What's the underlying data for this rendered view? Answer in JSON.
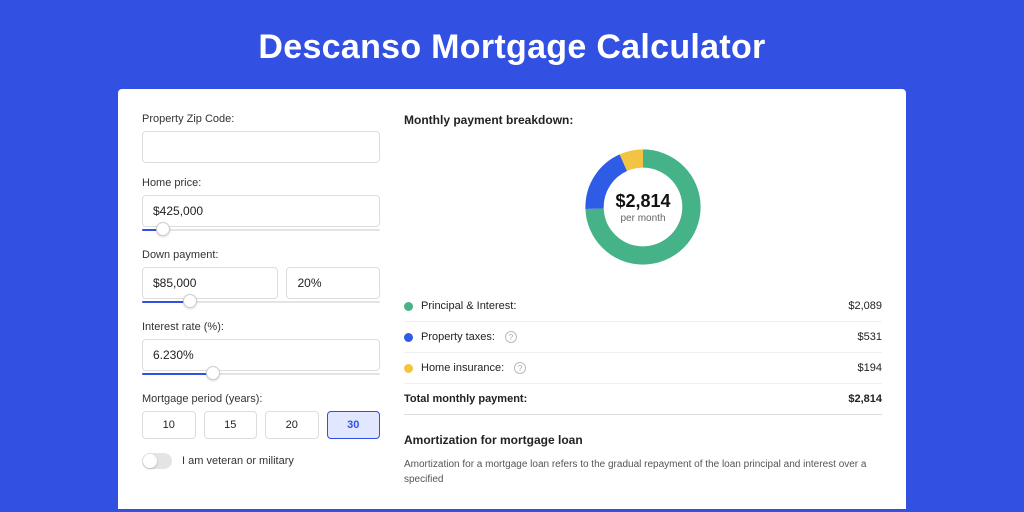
{
  "page": {
    "title": "Descanso Mortgage Calculator"
  },
  "form": {
    "zip": {
      "label": "Property Zip Code:",
      "value": ""
    },
    "home_price": {
      "label": "Home price:",
      "value": "$425,000",
      "slider_pct": 9
    },
    "down_payment": {
      "label": "Down payment:",
      "amount": "$85,000",
      "percent": "20%",
      "slider_pct": 20
    },
    "interest": {
      "label": "Interest rate (%):",
      "value": "6.230%",
      "slider_pct": 30
    },
    "period": {
      "label": "Mortgage period (years):",
      "options": [
        "10",
        "15",
        "20",
        "30"
      ],
      "active": "30"
    },
    "veteran": {
      "label": "I am veteran or military",
      "on": false
    }
  },
  "breakdown": {
    "title": "Monthly payment breakdown:",
    "total_amount": "$2,814",
    "per_month": "per month",
    "items": [
      {
        "label": "Principal & Interest:",
        "value": "$2,089",
        "color": "#45b387",
        "info": false
      },
      {
        "label": "Property taxes:",
        "value": "$531",
        "color": "#2e5ce6",
        "info": true
      },
      {
        "label": "Home insurance:",
        "value": "$194",
        "color": "#f3c444",
        "info": true
      }
    ],
    "total_row": {
      "label": "Total monthly payment:",
      "value": "$2,814"
    }
  },
  "amort": {
    "title": "Amortization for mortgage loan",
    "text": "Amortization for a mortgage loan refers to the gradual repayment of the loan principal and interest over a specified"
  },
  "chart_data": {
    "type": "pie",
    "title": "Monthly payment breakdown",
    "center_label": "$2,814 per month",
    "series": [
      {
        "name": "Principal & Interest",
        "value": 2089,
        "color": "#45b387"
      },
      {
        "name": "Property taxes",
        "value": 531,
        "color": "#2e5ce6"
      },
      {
        "name": "Home insurance",
        "value": 194,
        "color": "#f3c444"
      }
    ],
    "total": 2814
  }
}
